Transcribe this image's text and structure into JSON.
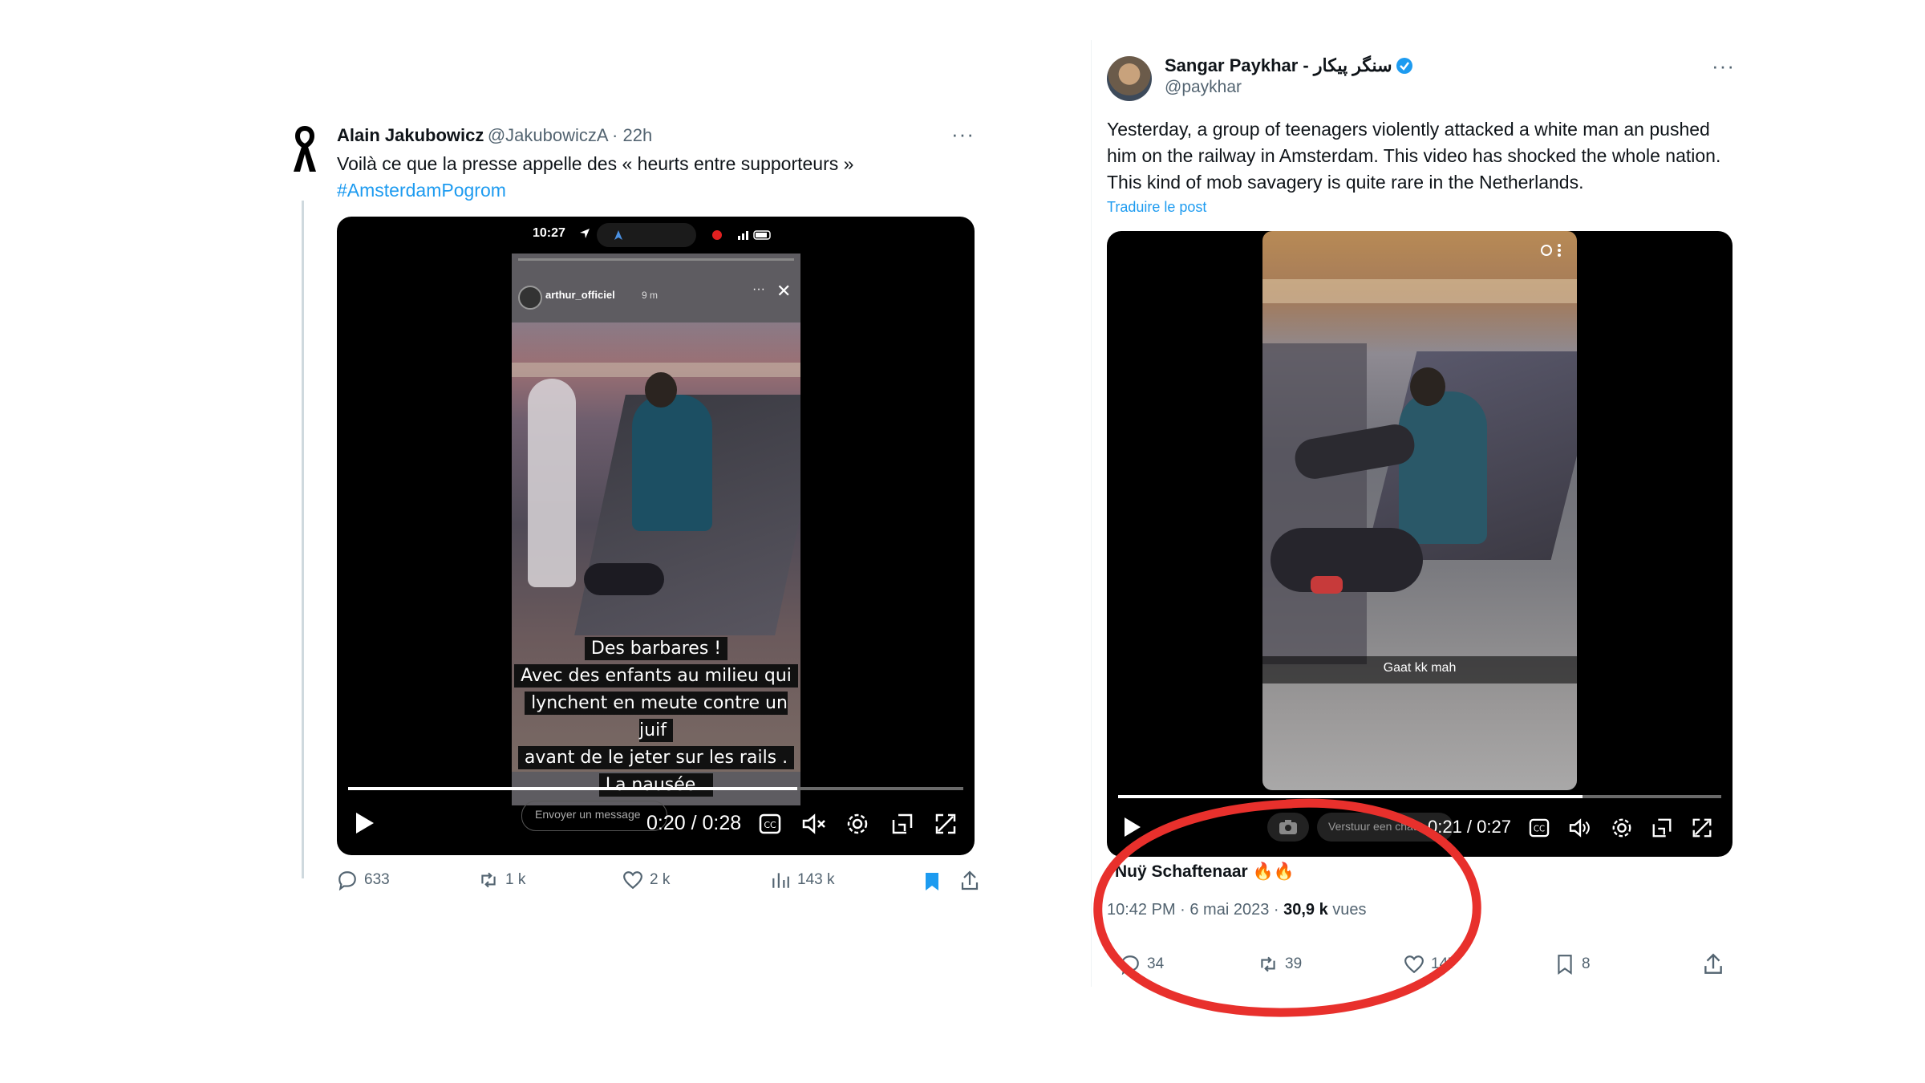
{
  "left_tweet": {
    "name": "Alain Jakubowicz",
    "handle": "@JakubowiczA",
    "time": "· 22h",
    "more": "···",
    "text": "Voilà ce que la presse appelle des « heurts entre supporteurs »",
    "hashtag": "#AmsterdamPogrom",
    "video": {
      "phone_time": "10:27",
      "story_user": "arthur_officiel",
      "story_age": "9 m",
      "caption_lines": [
        "Des barbares !",
        "Avec des enfants au milieu qui",
        "lynchent  en meute contre un juif",
        "avant de le jeter sur les rails .",
        "La nausée ."
      ],
      "message_placeholder": "Envoyer un message",
      "time_display": "0:20 / 0:28",
      "progress": 0.73
    },
    "actions": {
      "replies": "633",
      "reposts": "1 k",
      "likes": "2 k",
      "views": "143 k"
    }
  },
  "right_tweet": {
    "name": "Sangar Paykhar - سنگر پیکار",
    "handle": "@paykhar",
    "more": "···",
    "text": "Yesterday, a group of teenagers violently attacked a white man an pushed him on the railway in Amsterdam. This video has shocked the whole nation. This kind of mob savagery is quite rare in the Netherlands.",
    "translate": "Traduire le post",
    "video": {
      "caption": "Gaat kk mah",
      "message_placeholder": "Verstuur een chat",
      "time_display": "0:21 / 0:27",
      "progress": 0.77
    },
    "credit": "Nuÿ Schaftenaar 🔥🔥",
    "meta_time": "10:42 PM · 6 mai 2023 · ",
    "meta_views": "30,9 k",
    "meta_views_label": " vues",
    "actions": {
      "replies": "34",
      "reposts": "39",
      "likes": "147",
      "bookmarks": "8"
    }
  },
  "colors": {
    "link": "#1d9bf0",
    "annotation": "#e8302c",
    "verified": "#1d9bf0",
    "bookmark_active": "#1d9bf0"
  }
}
